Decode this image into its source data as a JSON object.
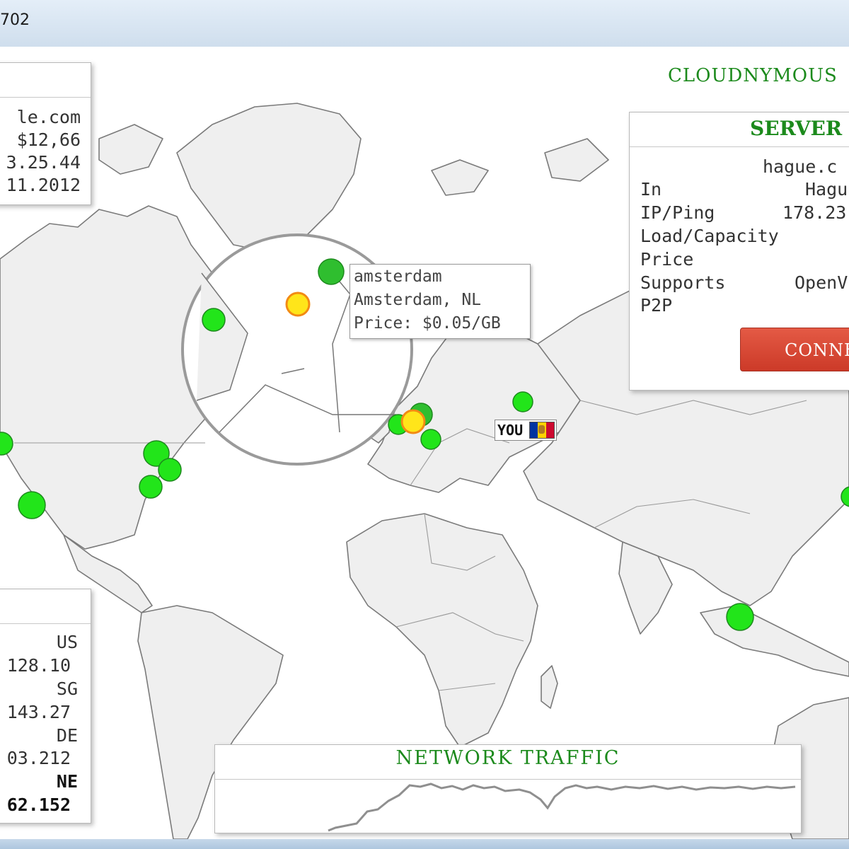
{
  "window": {
    "title": "702"
  },
  "brand": "CLOUDNYMOUS",
  "top_left_panel": {
    "rows": [
      "le.com",
      "$12,66",
      "3.25.44",
      "11.2012"
    ]
  },
  "server_panel": {
    "heading": "SERVER",
    "hostname": "hague.c",
    "rows": [
      {
        "label": "In",
        "value": "Hagu"
      },
      {
        "label": "IP/Ping",
        "value": "178.23"
      },
      {
        "label": "Load/Capacity",
        "value": ""
      },
      {
        "label": "Price",
        "value": ""
      },
      {
        "label": "Supports",
        "value": "OpenV"
      },
      {
        "label": "P2P",
        "value": ""
      }
    ],
    "connect_label": "CONNE"
  },
  "servers_list_panel": {
    "rows": [
      "US",
      "128.10",
      "SG",
      "143.27",
      "DE",
      "03.212",
      "NE",
      "62.152"
    ]
  },
  "tooltip": {
    "name": "amsterdam",
    "location": "Amsterdam, NL",
    "price": "Price: $0.05/GB"
  },
  "you_marker": {
    "label": "YOU",
    "flag_colors": [
      "#0033a0",
      "#ffd200",
      "#cc092f"
    ]
  },
  "network_traffic": {
    "title": "NETWORK TRAFFIC"
  },
  "colors": {
    "server_dot": "#22e51a",
    "selected_dot": "#ffe51a",
    "brand_green": "#1c8a1c",
    "connect_red": "#d8452f"
  }
}
